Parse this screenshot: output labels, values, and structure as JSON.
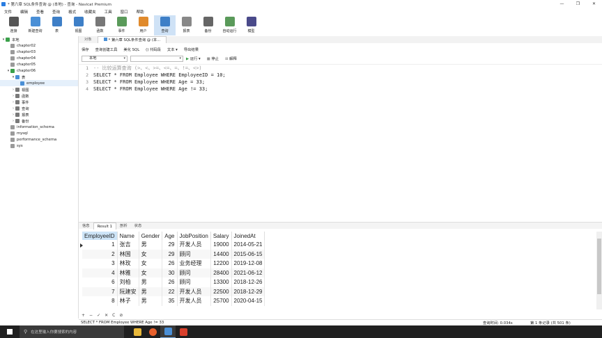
{
  "window": {
    "title": "* 第六章 SQL条件查询 @ (本地) - 查询 - Navicat Premium"
  },
  "menu": [
    "文件",
    "编辑",
    "查看",
    "查询",
    "格式",
    "收藏夹",
    "工具",
    "窗口",
    "帮助"
  ],
  "toolbar": [
    {
      "label": "连接",
      "icon": "plug-icon",
      "color": "#555555"
    },
    {
      "label": "新建查询",
      "icon": "new-query-icon",
      "color": "#4a8fd6"
    },
    {
      "label": "表",
      "icon": "table-icon",
      "color": "#3e7fc7"
    },
    {
      "label": "视图",
      "icon": "view-icon",
      "color": "#3e7fc7"
    },
    {
      "label": "函数",
      "icon": "function-icon",
      "color": "#777777"
    },
    {
      "label": "事件",
      "icon": "event-icon",
      "color": "#5a9a5a"
    },
    {
      "label": "用户",
      "icon": "user-icon",
      "color": "#e08a2c"
    },
    {
      "label": "查询",
      "icon": "query-icon",
      "color": "#3e7fc7"
    },
    {
      "label": "报表",
      "icon": "report-icon",
      "color": "#888888"
    },
    {
      "label": "备份",
      "icon": "backup-icon",
      "color": "#666666"
    },
    {
      "label": "自动运行",
      "icon": "autorun-icon",
      "color": "#5a9a5a"
    },
    {
      "label": "模型",
      "icon": "model-icon",
      "color": "#4a4a8a"
    }
  ],
  "tree": [
    {
      "label": "本地",
      "indent": 0,
      "arrow": "▾",
      "icon": "connection-icon",
      "color": "#3aa04a"
    },
    {
      "label": "chapter02",
      "indent": 1,
      "arrow": "",
      "icon": "database-icon",
      "color": "#9a9a9a"
    },
    {
      "label": "chapter03",
      "indent": 1,
      "arrow": "",
      "icon": "database-icon",
      "color": "#9a9a9a"
    },
    {
      "label": "chapter04",
      "indent": 1,
      "arrow": "",
      "icon": "database-icon",
      "color": "#9a9a9a"
    },
    {
      "label": "chapter05",
      "indent": 1,
      "arrow": "",
      "icon": "database-icon",
      "color": "#9a9a9a"
    },
    {
      "label": "chapter06",
      "indent": 1,
      "arrow": "▾",
      "icon": "database-icon",
      "color": "#3aa04a"
    },
    {
      "label": "表",
      "indent": 2,
      "arrow": "▾",
      "icon": "table-folder-icon",
      "color": "#4a8fd6"
    },
    {
      "label": "employee",
      "indent": 3,
      "arrow": "",
      "icon": "table-icon",
      "color": "#4a8fd6"
    },
    {
      "label": "视图",
      "indent": 2,
      "arrow": "›",
      "icon": "view-folder-icon",
      "color": "#7a7a7a"
    },
    {
      "label": "函数",
      "indent": 2,
      "arrow": "›",
      "icon": "function-folder-icon",
      "color": "#7a7a7a"
    },
    {
      "label": "事件",
      "indent": 2,
      "arrow": "›",
      "icon": "event-folder-icon",
      "color": "#7a7a7a"
    },
    {
      "label": "查询",
      "indent": 2,
      "arrow": "›",
      "icon": "query-folder-icon",
      "color": "#7a7a7a"
    },
    {
      "label": "报表",
      "indent": 2,
      "arrow": "›",
      "icon": "report-folder-icon",
      "color": "#7a7a7a"
    },
    {
      "label": "备份",
      "indent": 2,
      "arrow": "›",
      "icon": "backup-folder-icon",
      "color": "#7a7a7a"
    },
    {
      "label": "information_schema",
      "indent": 1,
      "arrow": "",
      "icon": "database-icon",
      "color": "#9a9a9a"
    },
    {
      "label": "mysql",
      "indent": 1,
      "arrow": "",
      "icon": "database-icon",
      "color": "#9a9a9a"
    },
    {
      "label": "performance_schema",
      "indent": 1,
      "arrow": "",
      "icon": "database-icon",
      "color": "#9a9a9a"
    },
    {
      "label": "sys",
      "indent": 1,
      "arrow": "",
      "icon": "database-icon",
      "color": "#9a9a9a"
    }
  ],
  "tabs": {
    "objects": "对象",
    "query_tab": "* 第六章 SQL条件查询 @ (本..."
  },
  "query_tools": [
    "保存",
    "查询创建工具",
    "美化 SQL",
    "() 代码段",
    "文本 ▾",
    "导出结果"
  ],
  "query_options": {
    "connection": "本地",
    "database": "",
    "run": "运行 ▾",
    "stop": "停止",
    "explain": "解释"
  },
  "editor": [
    {
      "ln": "1",
      "code": "-- 比较运算查询 (>、<、>=、<=、=、!=、<>)",
      "comment": true
    },
    {
      "ln": "2",
      "code": "SELECT * FROM Employee WHERE EmployeeID = 10;",
      "comment": false
    },
    {
      "ln": "3",
      "code": "SELECT * FROM Employee WHERE Age = 33;",
      "comment": false
    },
    {
      "ln": "4",
      "code": "SELECT * FROM Employee WHERE Age != 33;",
      "comment": false
    }
  ],
  "result_tabs": [
    "信息",
    "Result 1",
    "剖析",
    "状态"
  ],
  "result": {
    "columns": [
      "EmployeeID",
      "Name",
      "Gender",
      "Age",
      "JobPosition",
      "Salary",
      "JoinedAt"
    ],
    "rows": [
      [
        "1",
        "张吉",
        "男",
        "29",
        "开发人员",
        "19000",
        "2014-05-21"
      ],
      [
        "2",
        "林国",
        "女",
        "29",
        "顾问",
        "14400",
        "2015-06-15"
      ],
      [
        "3",
        "林玫",
        "女",
        "26",
        "业务经理",
        "12200",
        "2019-12-08"
      ],
      [
        "4",
        "林雅",
        "女",
        "30",
        "顾问",
        "28400",
        "2021-06-12"
      ],
      [
        "6",
        "刘柏",
        "男",
        "26",
        "顾问",
        "13300",
        "2018-12-26"
      ],
      [
        "7",
        "阮建安",
        "男",
        "22",
        "开发人员",
        "22500",
        "2018-12-29"
      ],
      [
        "8",
        "林子",
        "男",
        "35",
        "开发人员",
        "25700",
        "2020-04-15"
      ]
    ]
  },
  "grid_nav": [
    "+",
    "−",
    "✓",
    "✕",
    "C",
    "⊘"
  ],
  "status": {
    "sql": "SELECT * FROM Employee WHERE Age != 33",
    "query_time": "查询时间: 0.034s",
    "record": "第 1 条记录 (共 501 条)"
  },
  "taskbar": {
    "search_placeholder": "在这里输入你要搜索的内容"
  }
}
